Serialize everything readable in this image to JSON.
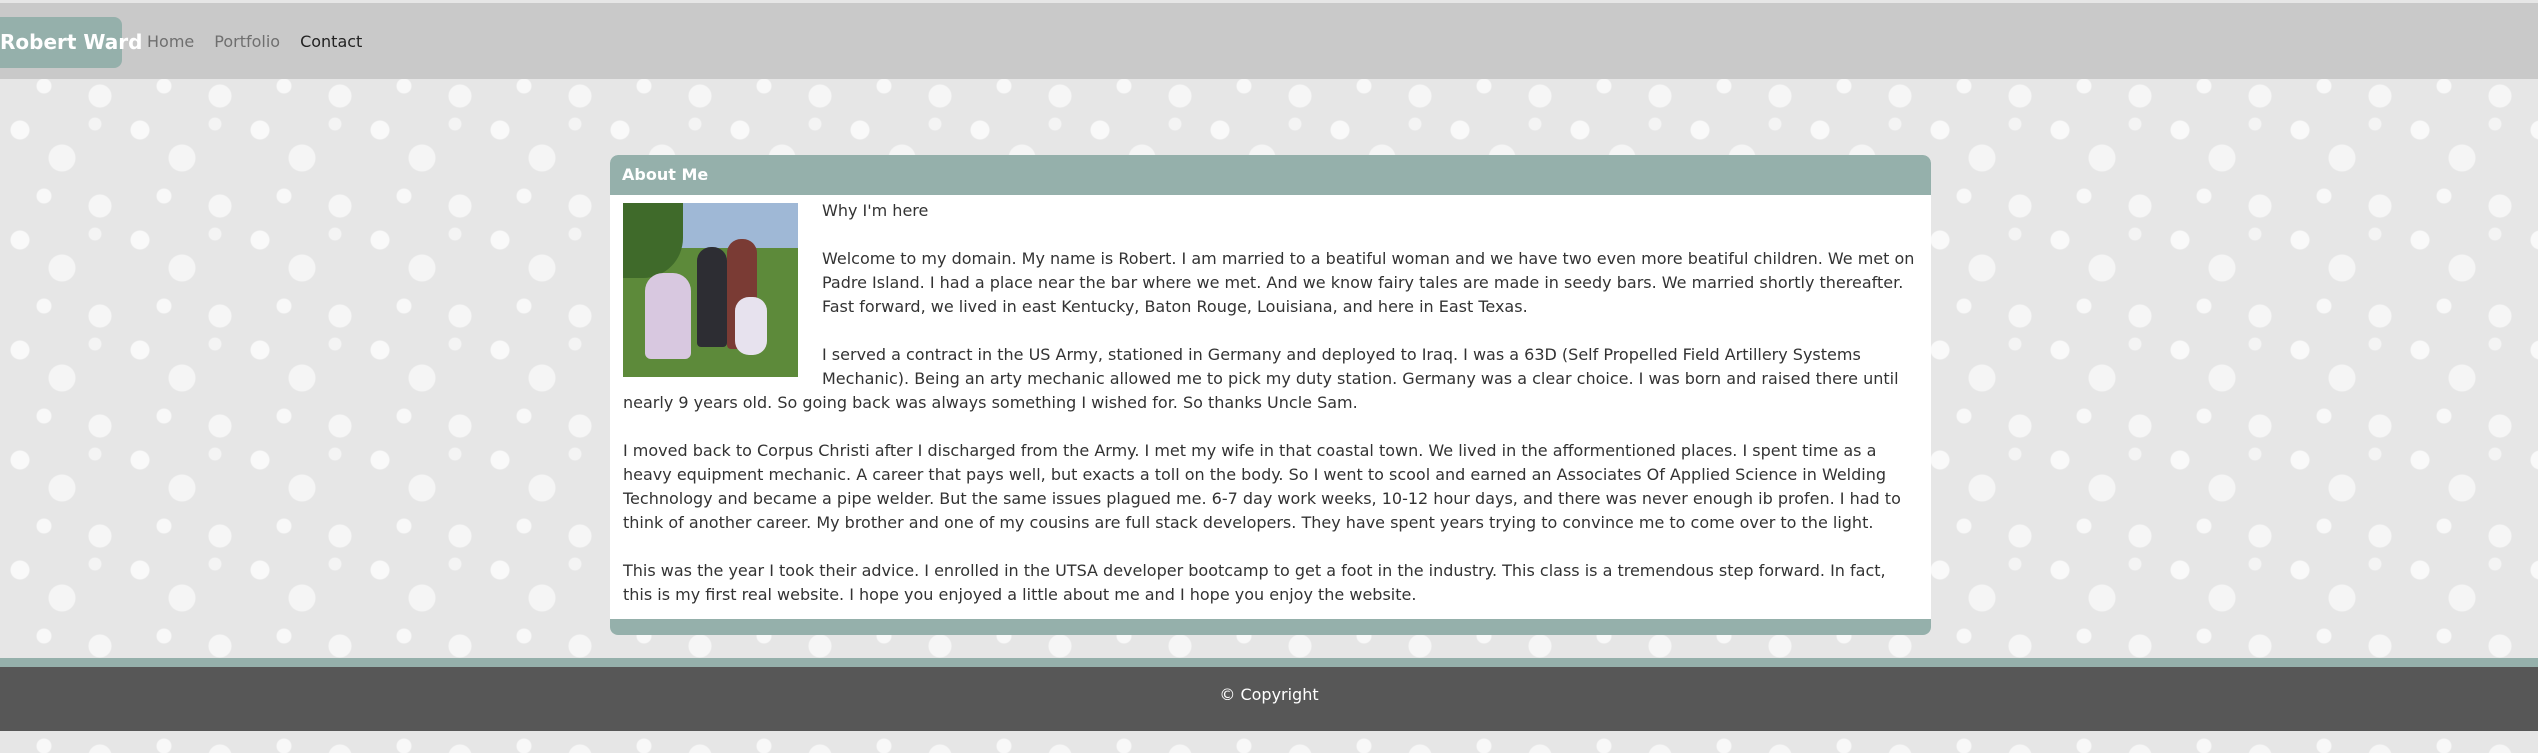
{
  "navbar": {
    "brand": "Robert Ward",
    "links": [
      {
        "label": "Home",
        "active": false
      },
      {
        "label": "Portfolio",
        "active": false
      },
      {
        "label": "Contact",
        "active": true
      }
    ]
  },
  "about": {
    "header": "About Me",
    "photo_alt": "Family photo",
    "subtitle": "Why I'm here",
    "paragraphs": [
      "Welcome to my domain. My name is Robert. I am married to a beatiful woman and we have two even more beatiful children. We met on Padre Island. I had a place near the bar where we met. And we know fairy tales are made in seedy bars. We married shortly thereafter. Fast forward, we lived in east Kentucky, Baton Rouge, Louisiana, and here in East Texas.",
      "I served a contract in the US Army, stationed in Germany and deployed to Iraq. I was a 63D (Self Propelled Field Artillery Systems Mechanic). Being an arty mechanic allowed me to pick my duty station. Germany was a clear choice. I was born and raised there until nearly 9 years old. So going back was always something I wished for. So thanks Uncle Sam.",
      "I moved back to Corpus Christi after I discharged from the Army. I met my wife in that coastal town. We lived in the afformentioned places. I spent time as a heavy equipment mechanic. A career that pays well, but exacts a toll on the body. So I went to scool and earned an Associates Of Applied Science in Welding Technology and became a pipe welder. But the same issues plagued me. 6-7 day work weeks, 10-12 hour days, and there was never enough ib profen. I had to think of another career. My brother and one of my cousins are full stack developers. They have spent years trying to convince me to come over to the light.",
      "This was the year I took their advice. I enrolled in the UTSA developer bootcamp to get a foot in the industry. This class is a tremendous step forward. In fact, this is my first real website. I hope you enjoyed a little about me and I hope you enjoy the website."
    ]
  },
  "footer": {
    "copyright": "© Copyright"
  },
  "colors": {
    "accent": "#95b0ab",
    "navbar": "#c9c9c9",
    "footer": "#575757"
  }
}
